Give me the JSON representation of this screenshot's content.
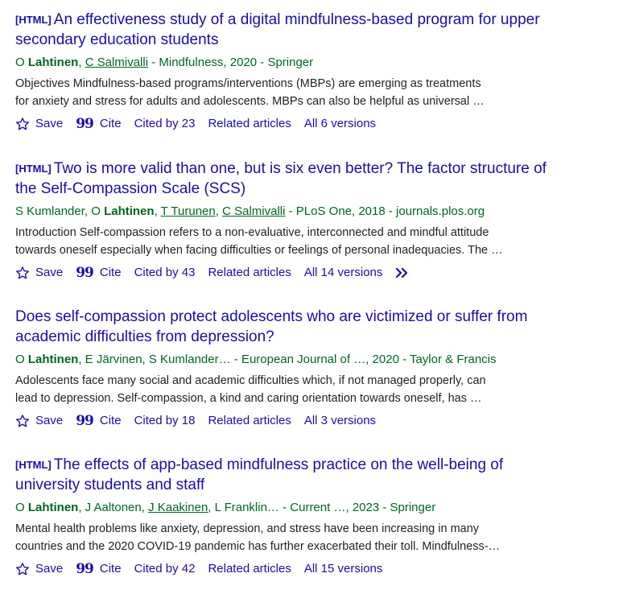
{
  "results": [
    {
      "tag": "[HTML]",
      "title_line1": "An effectiveness study of a digital mindfulness-based program for upper",
      "title_line2": "secondary education students",
      "authors": [
        {
          "text": "O ",
          "style": "plain"
        },
        {
          "text": "Lahtinen",
          "style": "bold"
        },
        {
          "text": ", ",
          "style": "plain"
        },
        {
          "text": "C Salmivalli",
          "style": "link"
        }
      ],
      "source": " - Mindfulness, 2020 - Springer",
      "snippet_line1": "Objectives Mindfulness-based programs/interventions (MBPs) are emerging as treatments",
      "snippet_line2": "for anxiety and stress for adults and adolescents. MBPs can also be helpful as universal …",
      "save_label": "Save",
      "cite_label": "Cite",
      "cited_by": "Cited by 23",
      "related": "Related articles",
      "versions": "All 6 versions"
    },
    {
      "tag": "[HTML]",
      "title_line1": "Two is more valid than one, but is six even better? The factor structure of",
      "title_line2": "the Self-Compassion Scale (SCS)",
      "authors": [
        {
          "text": "S Kumlander, O ",
          "style": "plain"
        },
        {
          "text": "Lahtinen",
          "style": "bold"
        },
        {
          "text": ", ",
          "style": "plain"
        },
        {
          "text": "T Turunen",
          "style": "link"
        },
        {
          "text": ", ",
          "style": "plain"
        },
        {
          "text": "C Salmivalli",
          "style": "link"
        }
      ],
      "source": " - PLoS One, 2018 - journals.plos.org",
      "snippet_line1": "Introduction Self-compassion refers to a non-evaluative, interconnected and mindful attitude",
      "snippet_line2": "towards oneself especially when facing difficulties or feelings of personal inadequacies. The …",
      "save_label": "Save",
      "cite_label": "Cite",
      "cited_by": "Cited by 43",
      "related": "Related articles",
      "versions": "All 14 versions"
    },
    {
      "tag": "",
      "title_line1": "Does self-compassion protect adolescents who are victimized or suffer from",
      "title_line2": "academic difficulties from depression?",
      "authors": [
        {
          "text": "O ",
          "style": "plain"
        },
        {
          "text": "Lahtinen",
          "style": "bold"
        },
        {
          "text": ", E Järvinen, S Kumlander…",
          "style": "plain"
        }
      ],
      "source": " - European Journal of …, 2020 - Taylor & Francis",
      "snippet_line1": "Adolescents face many social and academic difficulties which, if not managed properly, can",
      "snippet_line2": "lead to depression. Self-compassion, a kind and caring orientation towards oneself, has …",
      "save_label": "Save",
      "cite_label": "Cite",
      "cited_by": "Cited by 18",
      "related": "Related articles",
      "versions": "All 3 versions"
    },
    {
      "tag": "[HTML]",
      "title_line1": "The effects of app-based mindfulness practice on the well-being of",
      "title_line2": "university students and staff",
      "authors": [
        {
          "text": "O ",
          "style": "plain"
        },
        {
          "text": "Lahtinen",
          "style": "bold"
        },
        {
          "text": ", J Aaltonen, ",
          "style": "plain"
        },
        {
          "text": "J Kaakinen",
          "style": "link"
        },
        {
          "text": ", L Franklin…",
          "style": "plain"
        }
      ],
      "source": " - Current …, 2023 - Springer",
      "snippet_line1": "Mental health problems like anxiety, depression, and stress have been increasing in many",
      "snippet_line2": "countries and the 2020 COVID-19 pandemic has further exacerbated their toll. Mindfulness-…",
      "save_label": "Save",
      "cite_label": "Cite",
      "cited_by": "Cited by 42",
      "related": "Related articles",
      "versions": "All 15 versions"
    }
  ],
  "icons": {
    "save": "star-outline-icon",
    "cite": "quote-icon",
    "more": "double-chevron-right-icon"
  },
  "colors": {
    "link": "#1a0dab",
    "meta": "#006621",
    "snippet": "#222222"
  }
}
